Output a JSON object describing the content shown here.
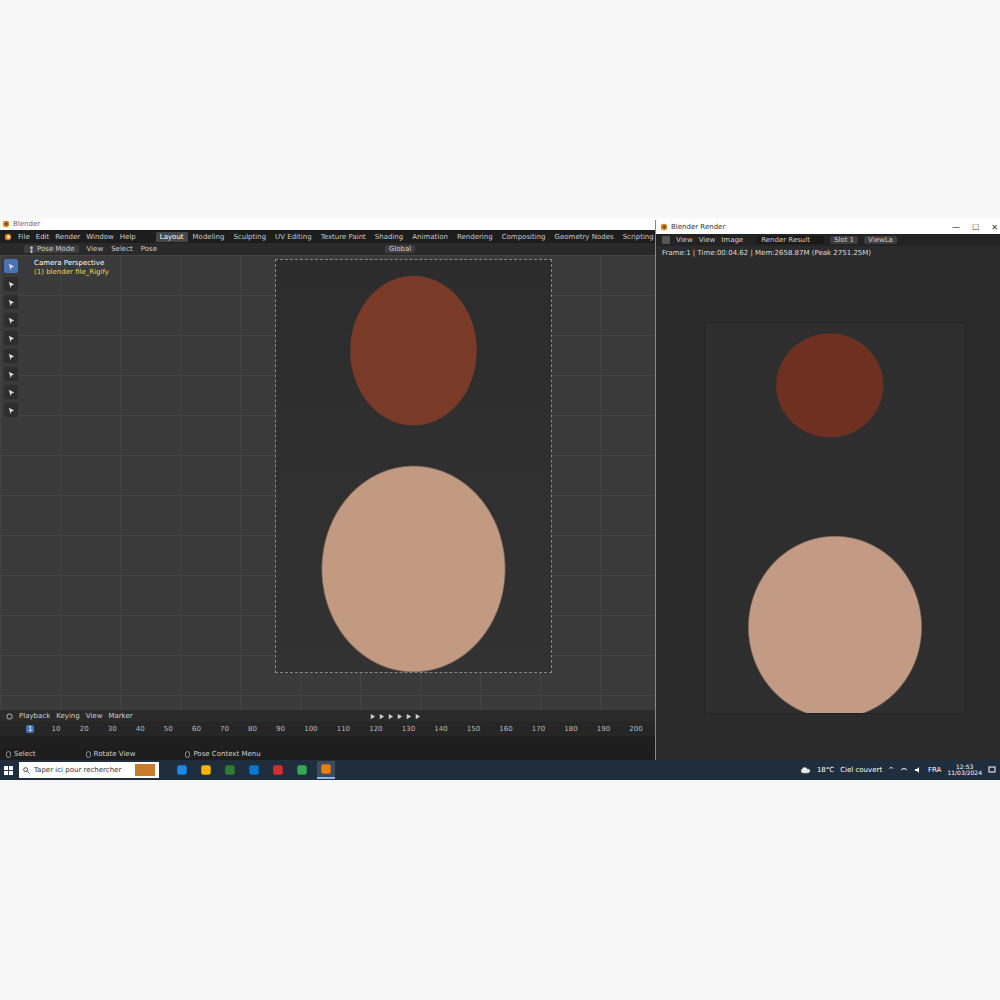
{
  "blender_window": {
    "title": "Blender",
    "logo": "",
    "menus": [
      "File",
      "Edit",
      "Render",
      "Window",
      "Help"
    ],
    "workspace_tabs": [
      {
        "label": "Layout",
        "selected": true
      },
      {
        "label": "Modeling",
        "selected": false
      },
      {
        "label": "Sculpting",
        "selected": false
      },
      {
        "label": "UV Editing",
        "selected": false
      },
      {
        "label": "Texture Paint",
        "selected": false
      },
      {
        "label": "Shading",
        "selected": false
      },
      {
        "label": "Animation",
        "selected": false
      },
      {
        "label": "Rendering",
        "selected": false
      },
      {
        "label": "Compositing",
        "selected": false
      },
      {
        "label": "Geometry Nodes",
        "selected": false
      },
      {
        "label": "Scripting",
        "selected": false
      }
    ],
    "add_tab": "+",
    "header": {
      "mode": "Pose Mode",
      "menus": [
        "View",
        "Select",
        "Pose"
      ],
      "orientation": "Global"
    },
    "viewport": {
      "camera_label": "Camera Perspective",
      "object_label": "(1) blender file_Rigify",
      "tools": [
        {
          "selected": true
        },
        {
          "selected": false
        },
        {
          "selected": false
        },
        {
          "selected": false
        },
        {
          "selected": false
        },
        {
          "selected": false
        },
        {
          "selected": false
        },
        {
          "selected": false
        },
        {
          "selected": false
        }
      ]
    },
    "timeline": {
      "menus": [
        "Playback",
        "Keying",
        "View",
        "Marker"
      ],
      "frames": [
        {
          "label": "1",
          "selected": true
        },
        {
          "label": "10",
          "selected": false
        },
        {
          "label": "20",
          "selected": false
        },
        {
          "label": "30",
          "selected": false
        },
        {
          "label": "40",
          "selected": false
        },
        {
          "label": "50",
          "selected": false
        },
        {
          "label": "60",
          "selected": false
        },
        {
          "label": "70",
          "selected": false
        },
        {
          "label": "80",
          "selected": false
        },
        {
          "label": "90",
          "selected": false
        },
        {
          "label": "100",
          "selected": false
        },
        {
          "label": "110",
          "selected": false
        },
        {
          "label": "120",
          "selected": false
        },
        {
          "label": "130",
          "selected": false
        },
        {
          "label": "140",
          "selected": false
        },
        {
          "label": "150",
          "selected": false
        },
        {
          "label": "160",
          "selected": false
        },
        {
          "label": "170",
          "selected": false
        },
        {
          "label": "180",
          "selected": false
        },
        {
          "label": "190",
          "selected": false
        },
        {
          "label": "200",
          "selected": false
        }
      ]
    },
    "status_bar": [
      "Select",
      "Rotate View",
      "Pose Context Menu"
    ]
  },
  "render_window": {
    "title": "Blender Render",
    "controls": [
      "—",
      "☐",
      "✕"
    ],
    "menus": [
      "View",
      "View",
      "Image"
    ],
    "image_name": "Render Result",
    "slot": "Slot 1",
    "view_layer": "ViewLa",
    "info": "Frame:1 | Time:00:04.62 | Mem:2658.87M (Peak 2751.25M)"
  },
  "taskbar": {
    "search_placeholder": "Taper ici pour rechercher",
    "temperature": "18°C",
    "weather": "Ciel couvert",
    "tray_arrow": "^",
    "language": "FRA",
    "time": "12:53",
    "date": "11/03/2024"
  }
}
